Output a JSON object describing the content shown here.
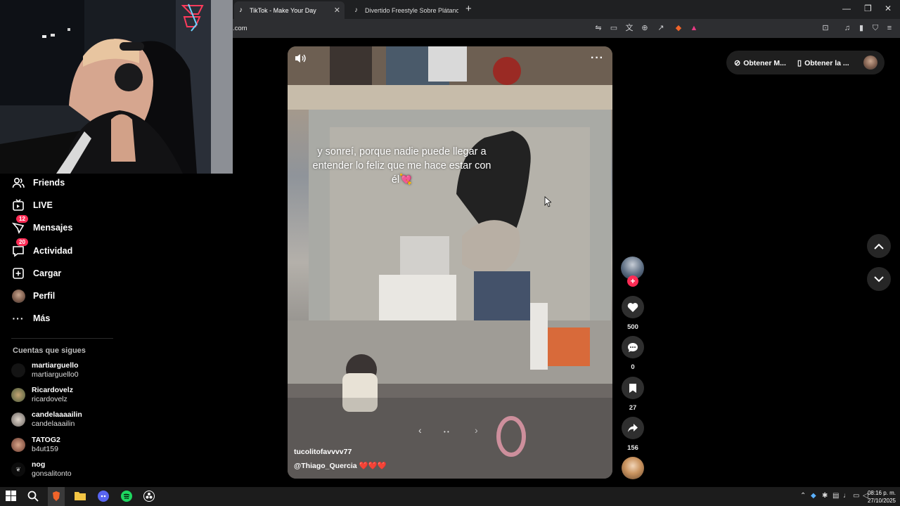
{
  "browser": {
    "tabs": [
      {
        "label": "TikTok - Make Your Day",
        "active": true
      },
      {
        "label": "Divertido Freestyle Sobre Plátanos | T",
        "active": false
      }
    ],
    "new_tab": "+",
    "url": ".com",
    "window_controls": {
      "minimize": "—",
      "restore": "❐",
      "close": "✕"
    }
  },
  "sidebar": {
    "nav": [
      {
        "label": "Friends",
        "icon": "friends-icon"
      },
      {
        "label": "LIVE",
        "icon": "live-icon"
      },
      {
        "label": "Mensajes",
        "icon": "messages-icon",
        "badge": "12"
      },
      {
        "label": "Actividad",
        "icon": "activity-icon",
        "badge": "20"
      },
      {
        "label": "Cargar",
        "icon": "upload-icon"
      },
      {
        "label": "Perfil",
        "icon": "profile-avatar"
      },
      {
        "label": "Más",
        "icon": "more-icon"
      }
    ],
    "following_title": "Cuentas que sigues",
    "following": [
      {
        "name": "martiarguello",
        "handle": "martiarguello0"
      },
      {
        "name": "Ricardovelz",
        "handle": "ricardovelz"
      },
      {
        "name": "candelaaaailin",
        "handle": "candelaaailin"
      },
      {
        "name": "TATOG2",
        "handle": "b4ut159"
      },
      {
        "name": "nog",
        "handle": "gonsalitonto"
      }
    ]
  },
  "video": {
    "caption": "y sonreí, porque nadie puede llegar a entender lo feliz que me hace estar con él💘",
    "author": "tucolitofavvvv77",
    "description": "@Thiago_Quercia ❤️❤️❤️"
  },
  "actions": {
    "likes": "500",
    "comments": "0",
    "saves": "27",
    "shares": "156"
  },
  "top_right": {
    "get_coins": "Obtener M...",
    "get_app": "Obtener la ..."
  },
  "taskbar": {
    "time": "08:16 p. m.",
    "date": "27/10/2025"
  },
  "colors": {
    "accent": "#fe2c55",
    "background": "#000000"
  }
}
